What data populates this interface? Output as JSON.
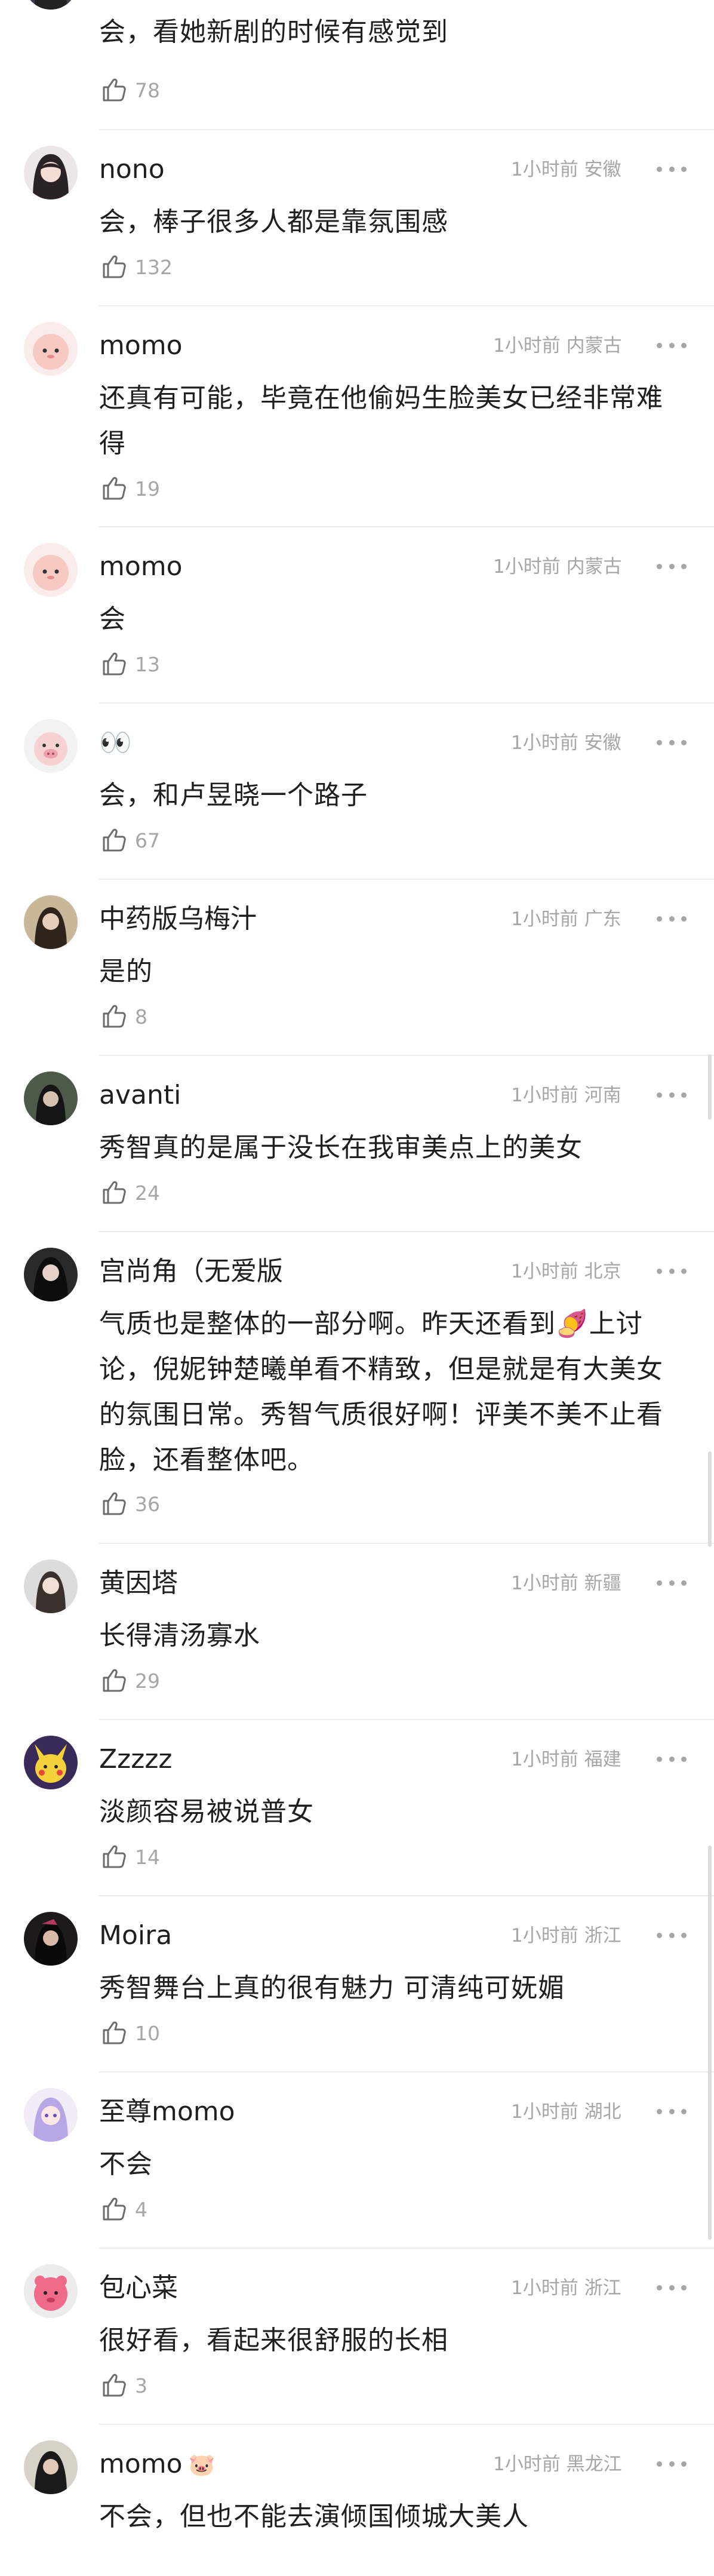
{
  "comments": [
    {
      "username": "",
      "time": "",
      "region": "",
      "text": "会，看她新剧的时候有感觉到",
      "likes": "78"
    },
    {
      "username": "nono",
      "time": "1小时前",
      "region": "安徽",
      "text": "会，棒子很多人都是靠氛围感",
      "likes": "132"
    },
    {
      "username": "momo",
      "time": "1小时前",
      "region": "内蒙古",
      "text": "还真有可能，毕竟在他偷妈生脸美女已经非常难得",
      "likes": "19"
    },
    {
      "username": "momo",
      "time": "1小时前",
      "region": "内蒙古",
      "text": "会",
      "likes": "13"
    },
    {
      "username": "👀",
      "time": "1小时前",
      "region": "安徽",
      "text": "会，和卢昱晓一个路子",
      "likes": "67"
    },
    {
      "username": "中药版乌梅汁",
      "time": "1小时前",
      "region": "广东",
      "text": "是的",
      "likes": "8"
    },
    {
      "username": "avanti",
      "time": "1小时前",
      "region": "河南",
      "text": "秀智真的是属于没长在我审美点上的美女",
      "likes": "24"
    },
    {
      "username": "宫尚角（无爱版",
      "time": "1小时前",
      "region": "北京",
      "text": "气质也是整体的一部分啊。昨天还看到🍠上讨论，倪妮钟楚曦单看不精致，但是就是有大美女的氛围日常。秀智气质很好啊！评美不美不止看脸，还看整体吧。",
      "likes": "36"
    },
    {
      "username": "黄因塔",
      "time": "1小时前",
      "region": "新疆",
      "text": "长得清汤寡水",
      "likes": "29"
    },
    {
      "username": "Zzzzz",
      "time": "1小时前",
      "region": "福建",
      "text": "淡颜容易被说普女",
      "likes": "14"
    },
    {
      "username": "Moira",
      "time": "1小时前",
      "region": "浙江",
      "text": "秀智舞台上真的很有魅力 可清纯可妩媚",
      "likes": "10"
    },
    {
      "username": "至尊momo",
      "time": "1小时前",
      "region": "湖北",
      "text": "不会",
      "likes": "4"
    },
    {
      "username": "包心菜",
      "time": "1小时前",
      "region": "浙江",
      "text": "很好看，看起来很舒服的长相",
      "likes": "3"
    },
    {
      "username": "momo",
      "badge": "🐷",
      "time": "1小时前",
      "region": "黑龙江",
      "text": "不会，但也不能去演倾国倾城大美人",
      "likes": ""
    }
  ]
}
